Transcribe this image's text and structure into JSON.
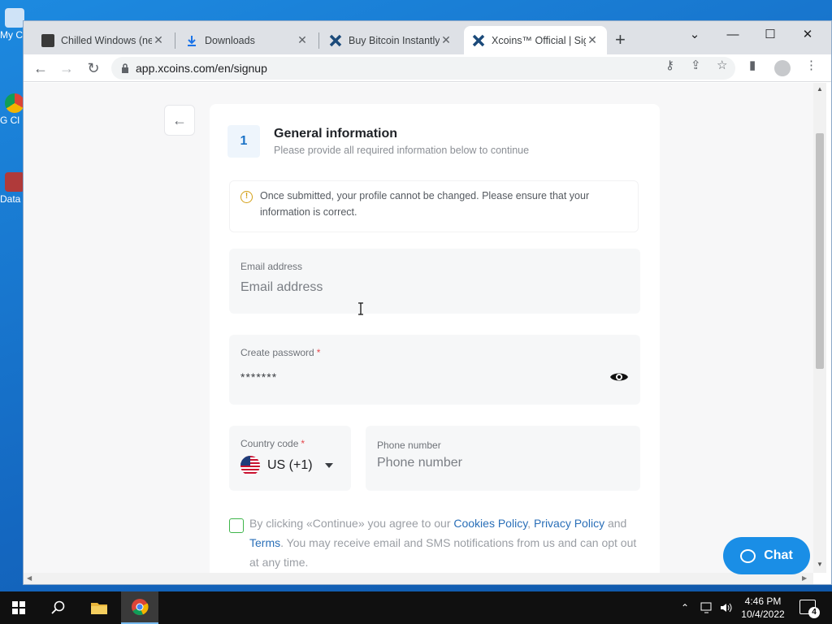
{
  "desktop": {
    "icons": [
      {
        "label": "My C",
        "icon": "computer-icon"
      },
      {
        "label": "G Cl",
        "icon": "chrome-shortcut-icon"
      },
      {
        "label": "Data",
        "icon": "data-shortcut-icon"
      }
    ]
  },
  "browser": {
    "tabs": [
      {
        "title": "Chilled Windows (new",
        "icon": "video-favicon",
        "active": false
      },
      {
        "title": "Downloads",
        "icon": "download-icon",
        "active": false
      },
      {
        "title": "Buy Bitcoin Instantly",
        "icon": "xcoins-favicon",
        "active": false
      },
      {
        "title": "Xcoins™ Official | Sig",
        "icon": "xcoins-favicon",
        "active": true
      }
    ],
    "url": "app.xcoins.com/en/signup"
  },
  "page": {
    "step": {
      "number": "1",
      "title": "General information",
      "subtitle": "Please provide all required information below to continue"
    },
    "notice": "Once submitted, your profile cannot be changed. Please ensure that your information is correct.",
    "email": {
      "label": "Email address",
      "placeholder": "Email address",
      "value": ""
    },
    "password": {
      "label": "Create password",
      "required_mark": "*",
      "value": "*******"
    },
    "country_code": {
      "label": "Country code",
      "required_mark": "*",
      "value": "US (+1)"
    },
    "phone": {
      "label": "Phone number",
      "placeholder": "Phone number"
    },
    "agreement": {
      "prefix": "By clicking «Continue» you agree to our ",
      "cookies_link": "Cookies Policy",
      "comma": ", ",
      "privacy_link": "Privacy Policy",
      "and": " and ",
      "terms_link": "Terms",
      "suffix": ". You may receive email and SMS notifications from us and can opt out at any time."
    },
    "chat_label": "Chat"
  },
  "taskbar": {
    "time": "4:46 PM",
    "date": "10/4/2022",
    "notification_count": "4"
  },
  "colors": {
    "accent": "#1b73c7",
    "chat": "#1a8ee6",
    "checkbox": "#3fb54a",
    "link": "#2a6fb8",
    "required": "#e5484d"
  }
}
